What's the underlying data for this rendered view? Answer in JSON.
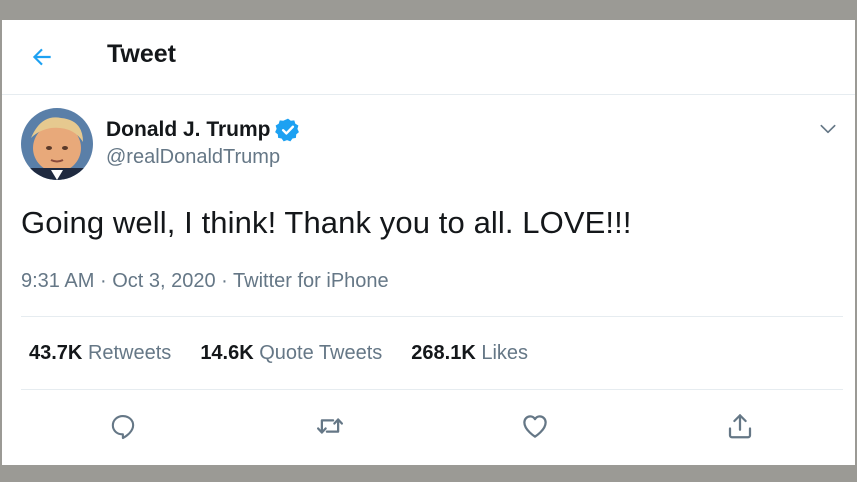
{
  "header": {
    "title": "Tweet",
    "back_icon": "arrow-left-icon"
  },
  "accent_color": "#1da1f2",
  "user": {
    "name": "Donald J. Trump",
    "handle": "@realDonaldTrump",
    "verified_icon": "verified-badge-icon"
  },
  "tweet": {
    "text": "Going well, I think! Thank you to all. LOVE!!!",
    "time": "9:31 AM",
    "separator": "·",
    "date": "Oct 3, 2020",
    "source": "Twitter for iPhone"
  },
  "stats": {
    "retweets": {
      "count": "43.7K",
      "label": "Retweets"
    },
    "quotes": {
      "count": "14.6K",
      "label": "Quote Tweets"
    },
    "likes": {
      "count": "268.1K",
      "label": "Likes"
    }
  },
  "actions": [
    "reply-icon",
    "retweet-icon",
    "like-icon",
    "share-icon"
  ]
}
